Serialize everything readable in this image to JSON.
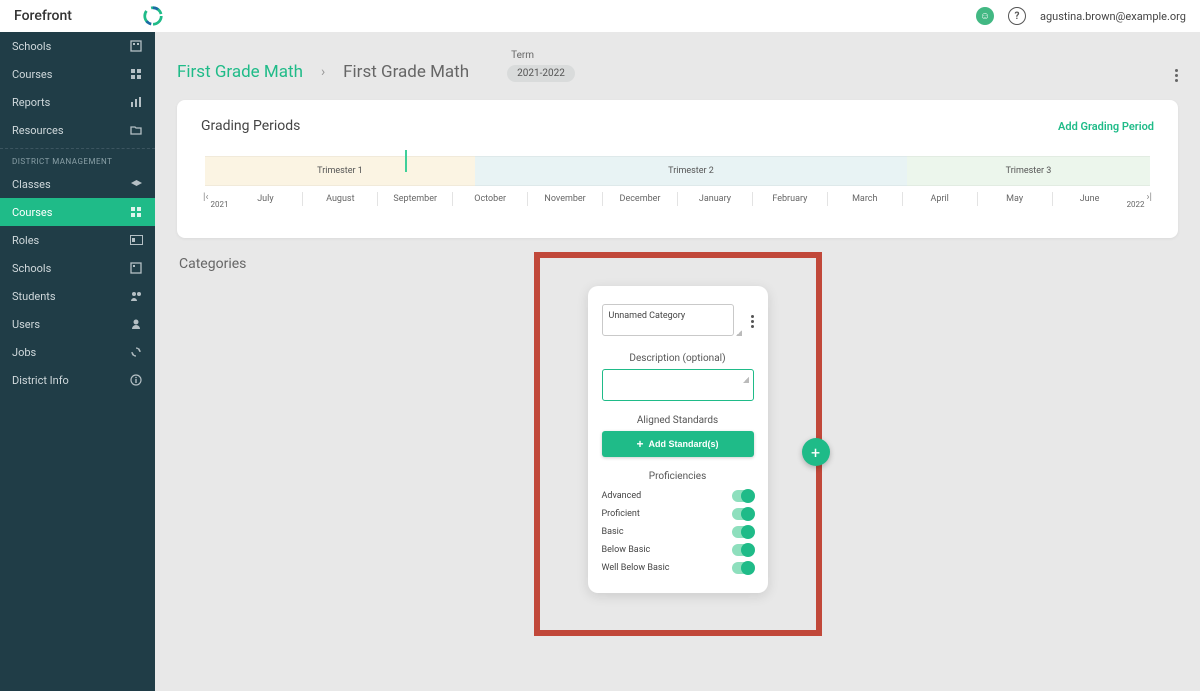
{
  "brand": {
    "name": "Forefront"
  },
  "user": {
    "email": "agustina.brown@example.org"
  },
  "sidebar": {
    "top": [
      {
        "label": "Schools",
        "icon": "building-icon"
      },
      {
        "label": "Courses",
        "icon": "grid-icon"
      },
      {
        "label": "Reports",
        "icon": "bars-icon"
      },
      {
        "label": "Resources",
        "icon": "folder-icon"
      }
    ],
    "section_label": "District Management",
    "mgmt": [
      {
        "label": "Classes",
        "icon": "grad-cap-icon"
      },
      {
        "label": "Courses",
        "icon": "grid-icon",
        "active": true
      },
      {
        "label": "Roles",
        "icon": "id-icon"
      },
      {
        "label": "Schools",
        "icon": "building-icon"
      },
      {
        "label": "Students",
        "icon": "people-icon"
      },
      {
        "label": "Users",
        "icon": "person-icon"
      },
      {
        "label": "Jobs",
        "icon": "sync-icon"
      },
      {
        "label": "District Info",
        "icon": "info-icon"
      }
    ]
  },
  "breadcrumb": {
    "root": "First Grade Math",
    "current": "First Grade Math",
    "term_label": "Term",
    "term_value": "2021-2022"
  },
  "grading": {
    "title": "Grading Periods",
    "add_label": "Add Grading Period",
    "year_start": "2021",
    "year_end": "2022",
    "trimesters": [
      {
        "label": "Trimester 1"
      },
      {
        "label": "Trimester 2"
      },
      {
        "label": "Trimester 3"
      }
    ],
    "months": [
      "July",
      "August",
      "September",
      "October",
      "November",
      "December",
      "January",
      "February",
      "March",
      "April",
      "May",
      "June"
    ]
  },
  "categories": {
    "title": "Categories",
    "card": {
      "name_value": "Unnamed Category",
      "desc_label": "Description (optional)",
      "aligned_label": "Aligned Standards",
      "add_std_label": "Add Standard(s)",
      "prof_label": "Proficiencies",
      "profs": [
        {
          "label": "Advanced",
          "on": true
        },
        {
          "label": "Proficient",
          "on": true
        },
        {
          "label": "Basic",
          "on": true
        },
        {
          "label": "Below Basic",
          "on": true
        },
        {
          "label": "Well Below Basic",
          "on": true
        }
      ]
    }
  }
}
